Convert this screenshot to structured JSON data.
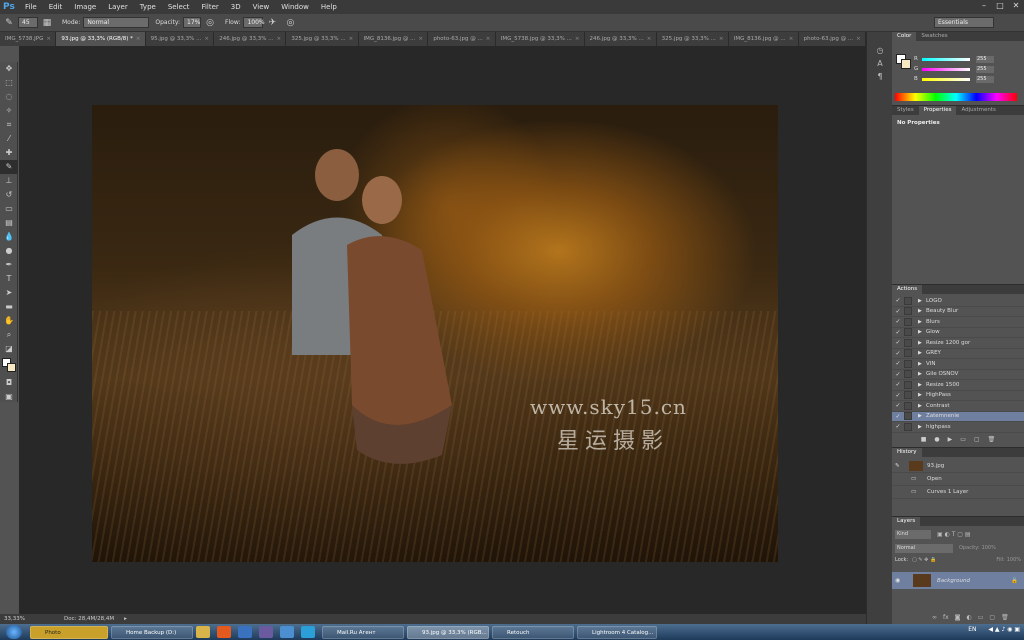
{
  "app": {
    "logo": "Ps"
  },
  "menu": [
    "File",
    "Edit",
    "Image",
    "Layer",
    "Type",
    "Select",
    "Filter",
    "3D",
    "View",
    "Window",
    "Help"
  ],
  "window_controls": [
    "–",
    "□",
    "✕"
  ],
  "options": {
    "brush_size": "45",
    "mode_label": "Mode:",
    "mode_value": "Normal",
    "opacity_label": "Opacity:",
    "opacity_value": "17%",
    "flow_label": "Flow:",
    "flow_value": "100%",
    "workspace": "Essentials"
  },
  "tabs": [
    {
      "label": "IMG_5738.JPG",
      "active": false
    },
    {
      "label": "93.jpg @ 33,3% (RGB/8) *",
      "active": true
    },
    {
      "label": "95.jpg @ 33,3% ...",
      "active": false
    },
    {
      "label": "246.jpg @ 33,3% ...",
      "active": false
    },
    {
      "label": "325.jpg @ 33,3% ...",
      "active": false
    },
    {
      "label": "IMG_8136.jpg @ ...",
      "active": false
    },
    {
      "label": "photo-63.jpg @ ...",
      "active": false
    },
    {
      "label": "IMG_5738.jpg @ 33,3% ...",
      "active": false
    },
    {
      "label": "246.jpg @ 33,3% ...",
      "active": false
    },
    {
      "label": "325.jpg @ 33,3% ...",
      "active": false
    },
    {
      "label": "IMG_8136.jpg @ ...",
      "active": false
    },
    {
      "label": "photo-63.jpg @ ...",
      "active": false
    }
  ],
  "watermark": {
    "url": "www.sky15.cn",
    "cn": "星运摄影"
  },
  "status": {
    "zoom": "33,33%",
    "doc": "Doc: 28,4M/28,4M"
  },
  "color_panel": {
    "tabs": [
      "Color",
      "Swatches"
    ],
    "r_label": "R",
    "r_value": "255",
    "g_label": "G",
    "g_value": "255",
    "b_label": "B",
    "b_value": "255"
  },
  "properties_panel": {
    "tabs": [
      "Styles",
      "Properties",
      "Adjustments"
    ],
    "content": "No Properties"
  },
  "actions_panel": {
    "title": "Actions",
    "items": [
      "LOGO",
      "Beauty Blur",
      "Blurs",
      "Glow",
      "Resize 1200 gor",
      "GREY",
      "VIN",
      "Gile OSNOV",
      "Resize 1500",
      "HighPass",
      "Contrast",
      "Zatemnenie",
      "highpass"
    ],
    "highlighted": "Zatemnenie"
  },
  "history_panel": {
    "title": "History",
    "snapshot": "93.jpg",
    "items": [
      "Open",
      "Curves 1 Layer"
    ]
  },
  "layers_panel": {
    "title": "Layers",
    "filter": "Kind",
    "blend": "Normal",
    "opacity_label": "Opacity:",
    "opacity": "100%",
    "lock_label": "Lock:",
    "fill_label": "Fill:",
    "fill": "100%",
    "layer_name": "Background"
  },
  "taskbar": {
    "items": [
      "Photo",
      "Home Backup (D:)",
      "Mail.Ru Агент",
      "93.jpg @ 33,3% (RGB...",
      "Retouch",
      "Lightroom 4 Catalog..."
    ],
    "lang": "EN"
  }
}
